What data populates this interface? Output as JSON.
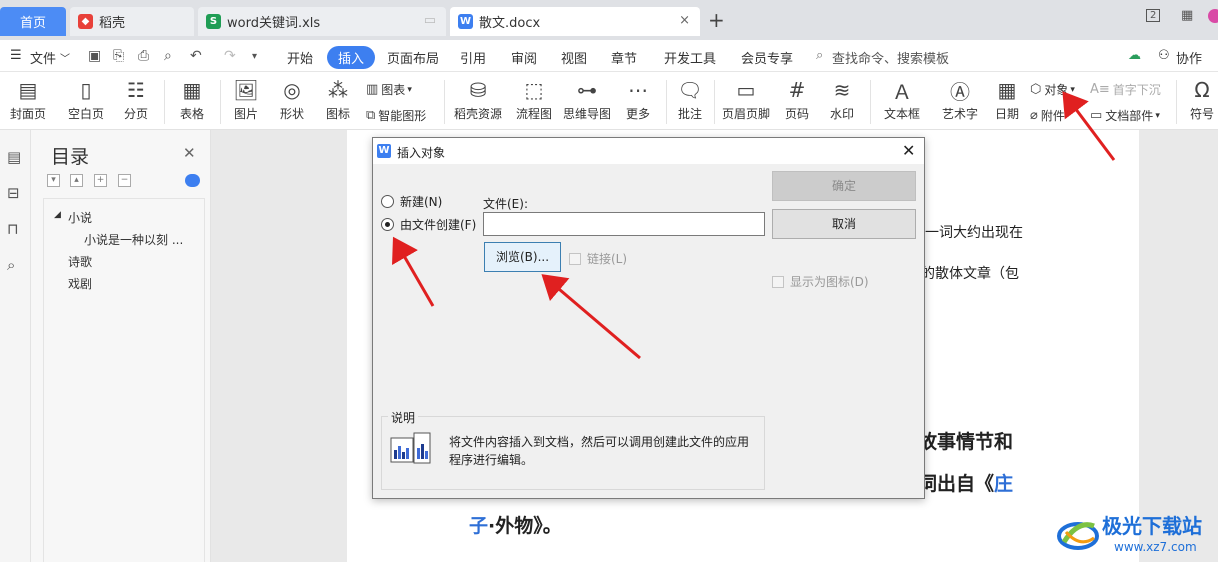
{
  "tabs": [
    {
      "label": "首页"
    },
    {
      "label": "稻壳"
    },
    {
      "label": "word关键词.xls"
    },
    {
      "label": "散文.docx"
    }
  ],
  "window": {
    "add_tab": "+",
    "close": "×"
  },
  "menu": {
    "file": "文件",
    "items": [
      "开始",
      "插入",
      "页面布局",
      "引用",
      "审阅",
      "视图",
      "章节",
      "开发工具",
      "会员专享"
    ],
    "search_placeholder": "查找命令、搜索模板",
    "collab": "协作"
  },
  "ribbon": {
    "cover": "封面页",
    "blank": "空白页",
    "pagebreak": "分页",
    "table": "表格",
    "picture": "图片",
    "shape": "形状",
    "icon": "图标",
    "chart": "图表",
    "smart_graphic": "智能图形",
    "daoke_res": "稻壳资源",
    "flowchart": "流程图",
    "mindmap": "思维导图",
    "more": "更多",
    "comment": "批注",
    "header_footer": "页眉页脚",
    "page_number": "页码",
    "watermark": "水印",
    "textbox": "文本框",
    "wordart": "艺术字",
    "date": "日期",
    "object": "对象",
    "dropcap": "首字下沉",
    "attachment": "附件",
    "doc_parts": "文档部件",
    "symbol": "符号"
  },
  "toc": {
    "title": "目录",
    "items": [
      "小说",
      "小说是一种以刻 ...",
      "诗歌",
      "戏剧"
    ]
  },
  "document": {
    "line1": "一词大约出现在",
    "line2": "的散体文章（包",
    "line3": "故事情节和",
    "line4a": "词出自《",
    "line4b": "庄",
    "line5a": "子",
    "line5b": "·外物》。"
  },
  "dialog": {
    "title": "插入对象",
    "radio_new": "新建(N)",
    "radio_from_file": "由文件创建(F)",
    "file_label": "文件(E):",
    "file_value": "",
    "browse": "浏览(B)...",
    "link": "链接(L)",
    "show_as_icon": "显示为图标(D)",
    "ok": "确定",
    "cancel": "取消",
    "desc_label": "说明",
    "desc_text": "将文件内容插入到文档，然后可以调用创建此文件的应用程序进行编辑。"
  },
  "watermark": {
    "title": "极光下载站",
    "url": "www.xz7.com"
  },
  "colors": {
    "accent": "#3d7ff0",
    "arrow": "#e02020",
    "dialog_bg": "#f0f0f0"
  }
}
